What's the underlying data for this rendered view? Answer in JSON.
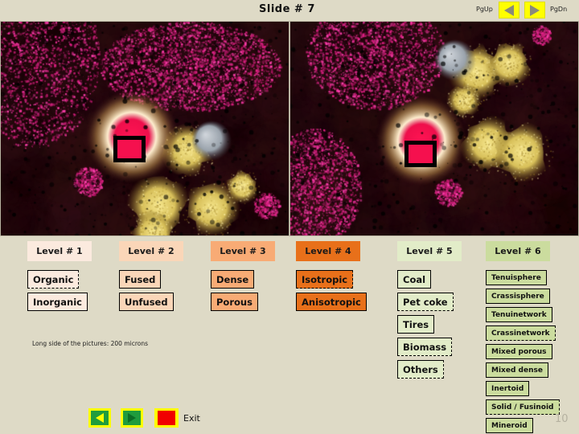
{
  "header": {
    "title": "Slide  # 7",
    "pgup_label": "PgUp",
    "pgdn_label": "PgDn",
    "prev_icon": "triangle-left-icon",
    "next_icon": "triangle-right-icon"
  },
  "images": [
    {
      "name": "microscopy-image-left",
      "highlight_color": "#f5104e"
    },
    {
      "name": "microscopy-image-right",
      "highlight_color": "#f5104e"
    }
  ],
  "caption": "Long side of the pictures: 200 microns",
  "levels": [
    {
      "header": "Level # 1",
      "header_bg": "#fbeade",
      "box_bg": "#fbeade",
      "items": [
        {
          "label": "Organic",
          "shadow": true
        },
        {
          "label": "Inorganic",
          "shadow": false
        }
      ]
    },
    {
      "header": "Level # 2",
      "header_bg": "#fad6b8",
      "box_bg": "#fad6b8",
      "items": [
        {
          "label": "Fused",
          "shadow": false
        },
        {
          "label": "Unfused",
          "shadow": false
        }
      ]
    },
    {
      "header": "Level # 3",
      "header_bg": "#f8ab75",
      "box_bg": "#f8ab75",
      "items": [
        {
          "label": "Dense",
          "shadow": false
        },
        {
          "label": "Porous",
          "shadow": false
        }
      ]
    },
    {
      "header": "Level # 4",
      "header_bg": "#e8701a",
      "box_bg": "#e8701a",
      "items": [
        {
          "label": "Isotropic",
          "shadow": true
        },
        {
          "label": "Anisotropic",
          "shadow": false
        }
      ]
    },
    {
      "header": "Level # 5",
      "header_bg": "#e2ecc8",
      "box_bg": "#e2ecc8",
      "items": [
        {
          "label": "Coal",
          "shadow": false
        },
        {
          "label": "Pet coke",
          "shadow": true
        },
        {
          "label": "Tires",
          "shadow": false
        },
        {
          "label": "Biomass",
          "shadow": true
        },
        {
          "label": "Others",
          "shadow": true
        }
      ]
    },
    {
      "header": "Level # 6",
      "header_bg": "#cbdc9e",
      "box_bg": "#cbdc9e",
      "items": [
        {
          "label": "Tenuisphere",
          "shadow": false
        },
        {
          "label": "Crassisphere",
          "shadow": false
        },
        {
          "label": "Tenuinetwork",
          "shadow": false
        },
        {
          "label": "Crassinetwork",
          "shadow": true
        },
        {
          "label": "Mixed porous",
          "shadow": false
        },
        {
          "label": "Mixed dense",
          "shadow": false
        },
        {
          "label": "Inertoid",
          "shadow": false
        },
        {
          "label": "Solid / Fusinoid",
          "shadow": true
        },
        {
          "label": "Mineroid",
          "shadow": false
        }
      ]
    }
  ],
  "footer": {
    "prev_icon": "triangle-left-icon",
    "next_icon": "triangle-right-icon",
    "exit_label": "Exit",
    "exit_icon": "red-square-icon",
    "page_number": "10"
  },
  "colors": {
    "background": "#dedac6",
    "accent_yellow": "#ffff00",
    "accent_green": "#1f9c3d",
    "accent_red": "#f10000"
  }
}
